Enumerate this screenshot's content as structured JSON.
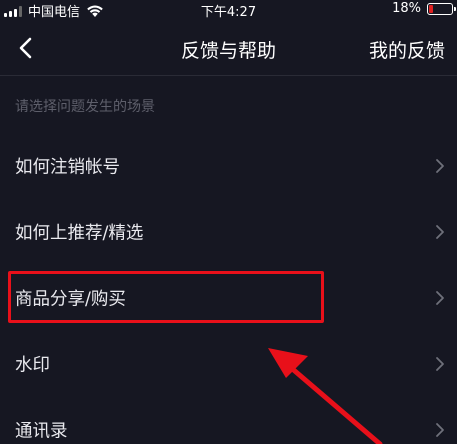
{
  "status_bar": {
    "carrier": "中国电信",
    "time": "下午4:27",
    "battery": "18%",
    "battery_level": 0.18
  },
  "nav": {
    "title": "反馈与帮助",
    "right_action": "我的反馈",
    "back_icon": "chevron-left-icon"
  },
  "section_hint": "请选择问题发生的场景",
  "items": [
    {
      "label": "如何注销帐号"
    },
    {
      "label": "如何上推荐/精选"
    },
    {
      "label": "商品分享/购买"
    },
    {
      "label": "水印"
    },
    {
      "label": "通讯录"
    }
  ],
  "colors": {
    "background": "#161722",
    "highlight": "#e8101a",
    "hint_text": "#5e5f6b"
  }
}
